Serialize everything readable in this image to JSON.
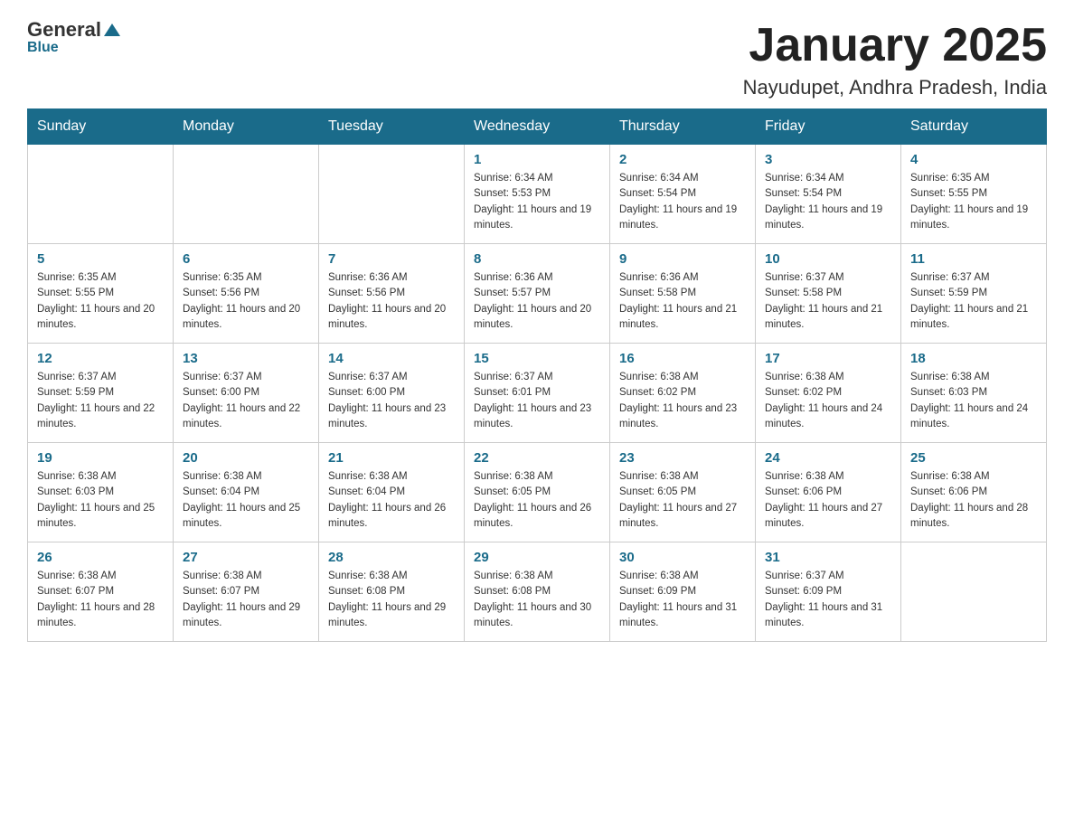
{
  "header": {
    "logo_general": "General",
    "logo_blue": "Blue",
    "month_title": "January 2025",
    "location": "Nayudupet, Andhra Pradesh, India"
  },
  "days_of_week": [
    "Sunday",
    "Monday",
    "Tuesday",
    "Wednesday",
    "Thursday",
    "Friday",
    "Saturday"
  ],
  "weeks": [
    [
      {
        "day": "",
        "info": ""
      },
      {
        "day": "",
        "info": ""
      },
      {
        "day": "",
        "info": ""
      },
      {
        "day": "1",
        "info": "Sunrise: 6:34 AM\nSunset: 5:53 PM\nDaylight: 11 hours and 19 minutes."
      },
      {
        "day": "2",
        "info": "Sunrise: 6:34 AM\nSunset: 5:54 PM\nDaylight: 11 hours and 19 minutes."
      },
      {
        "day": "3",
        "info": "Sunrise: 6:34 AM\nSunset: 5:54 PM\nDaylight: 11 hours and 19 minutes."
      },
      {
        "day": "4",
        "info": "Sunrise: 6:35 AM\nSunset: 5:55 PM\nDaylight: 11 hours and 19 minutes."
      }
    ],
    [
      {
        "day": "5",
        "info": "Sunrise: 6:35 AM\nSunset: 5:55 PM\nDaylight: 11 hours and 20 minutes."
      },
      {
        "day": "6",
        "info": "Sunrise: 6:35 AM\nSunset: 5:56 PM\nDaylight: 11 hours and 20 minutes."
      },
      {
        "day": "7",
        "info": "Sunrise: 6:36 AM\nSunset: 5:56 PM\nDaylight: 11 hours and 20 minutes."
      },
      {
        "day": "8",
        "info": "Sunrise: 6:36 AM\nSunset: 5:57 PM\nDaylight: 11 hours and 20 minutes."
      },
      {
        "day": "9",
        "info": "Sunrise: 6:36 AM\nSunset: 5:58 PM\nDaylight: 11 hours and 21 minutes."
      },
      {
        "day": "10",
        "info": "Sunrise: 6:37 AM\nSunset: 5:58 PM\nDaylight: 11 hours and 21 minutes."
      },
      {
        "day": "11",
        "info": "Sunrise: 6:37 AM\nSunset: 5:59 PM\nDaylight: 11 hours and 21 minutes."
      }
    ],
    [
      {
        "day": "12",
        "info": "Sunrise: 6:37 AM\nSunset: 5:59 PM\nDaylight: 11 hours and 22 minutes."
      },
      {
        "day": "13",
        "info": "Sunrise: 6:37 AM\nSunset: 6:00 PM\nDaylight: 11 hours and 22 minutes."
      },
      {
        "day": "14",
        "info": "Sunrise: 6:37 AM\nSunset: 6:00 PM\nDaylight: 11 hours and 23 minutes."
      },
      {
        "day": "15",
        "info": "Sunrise: 6:37 AM\nSunset: 6:01 PM\nDaylight: 11 hours and 23 minutes."
      },
      {
        "day": "16",
        "info": "Sunrise: 6:38 AM\nSunset: 6:02 PM\nDaylight: 11 hours and 23 minutes."
      },
      {
        "day": "17",
        "info": "Sunrise: 6:38 AM\nSunset: 6:02 PM\nDaylight: 11 hours and 24 minutes."
      },
      {
        "day": "18",
        "info": "Sunrise: 6:38 AM\nSunset: 6:03 PM\nDaylight: 11 hours and 24 minutes."
      }
    ],
    [
      {
        "day": "19",
        "info": "Sunrise: 6:38 AM\nSunset: 6:03 PM\nDaylight: 11 hours and 25 minutes."
      },
      {
        "day": "20",
        "info": "Sunrise: 6:38 AM\nSunset: 6:04 PM\nDaylight: 11 hours and 25 minutes."
      },
      {
        "day": "21",
        "info": "Sunrise: 6:38 AM\nSunset: 6:04 PM\nDaylight: 11 hours and 26 minutes."
      },
      {
        "day": "22",
        "info": "Sunrise: 6:38 AM\nSunset: 6:05 PM\nDaylight: 11 hours and 26 minutes."
      },
      {
        "day": "23",
        "info": "Sunrise: 6:38 AM\nSunset: 6:05 PM\nDaylight: 11 hours and 27 minutes."
      },
      {
        "day": "24",
        "info": "Sunrise: 6:38 AM\nSunset: 6:06 PM\nDaylight: 11 hours and 27 minutes."
      },
      {
        "day": "25",
        "info": "Sunrise: 6:38 AM\nSunset: 6:06 PM\nDaylight: 11 hours and 28 minutes."
      }
    ],
    [
      {
        "day": "26",
        "info": "Sunrise: 6:38 AM\nSunset: 6:07 PM\nDaylight: 11 hours and 28 minutes."
      },
      {
        "day": "27",
        "info": "Sunrise: 6:38 AM\nSunset: 6:07 PM\nDaylight: 11 hours and 29 minutes."
      },
      {
        "day": "28",
        "info": "Sunrise: 6:38 AM\nSunset: 6:08 PM\nDaylight: 11 hours and 29 minutes."
      },
      {
        "day": "29",
        "info": "Sunrise: 6:38 AM\nSunset: 6:08 PM\nDaylight: 11 hours and 30 minutes."
      },
      {
        "day": "30",
        "info": "Sunrise: 6:38 AM\nSunset: 6:09 PM\nDaylight: 11 hours and 31 minutes."
      },
      {
        "day": "31",
        "info": "Sunrise: 6:37 AM\nSunset: 6:09 PM\nDaylight: 11 hours and 31 minutes."
      },
      {
        "day": "",
        "info": ""
      }
    ]
  ]
}
